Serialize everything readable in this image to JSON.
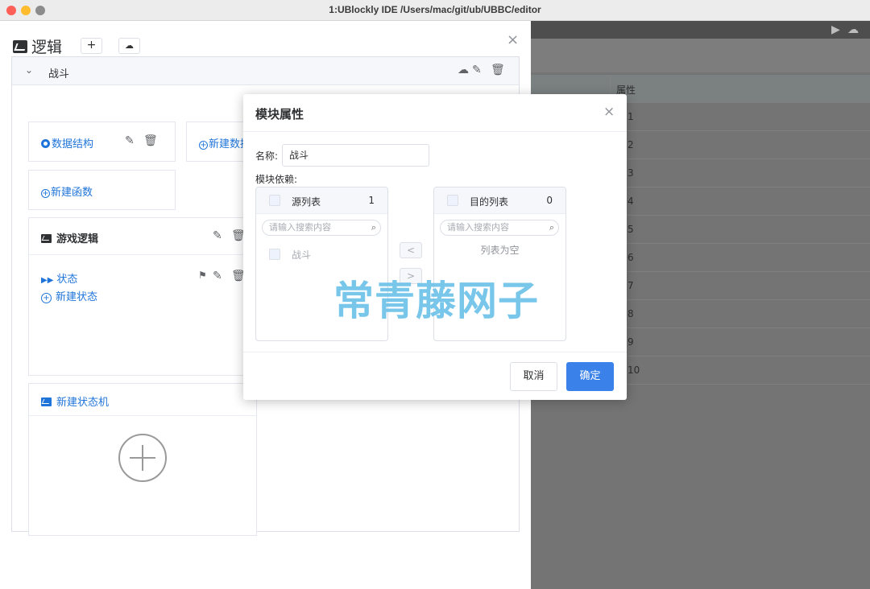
{
  "window": {
    "title": "1:UBlockly IDE /Users/mac/git/ub/UBBC/editor"
  },
  "background": {
    "table_header": "属性",
    "rows": [
      "1",
      "2",
      "3",
      "4",
      "5",
      "6",
      "7",
      "8",
      "9",
      "10"
    ]
  },
  "drawer": {
    "title": "逻辑",
    "add_button": "+",
    "close": "×",
    "module": {
      "name": "战斗",
      "data_structure_link": "数据结构",
      "new_data_link": "新建数据",
      "new_function_link": "新建函数",
      "game_logic": {
        "title": "游戏逻辑",
        "state_item": "状态",
        "new_state": "新建状态"
      },
      "new_state_machine": "新建状态机"
    }
  },
  "dialog": {
    "title": "模块属性",
    "close": "×",
    "name_label": "名称:",
    "name_value": "战斗",
    "deps_label": "模块依赖:",
    "source": {
      "title": "源列表",
      "count": "1",
      "search_placeholder": "请输入搜索内容",
      "items": [
        "战斗"
      ]
    },
    "target": {
      "title": "目的列表",
      "count": "0",
      "search_placeholder": "请输入搜索内容",
      "empty_text": "列表为空"
    },
    "move_left": "<",
    "move_right": ">",
    "cancel_label": "取消",
    "ok_label": "确定"
  },
  "watermark": "常青藤网子",
  "colors": {
    "link": "#1f74d9",
    "primary": "#3a82e9",
    "watermark": "#66bfe8"
  }
}
